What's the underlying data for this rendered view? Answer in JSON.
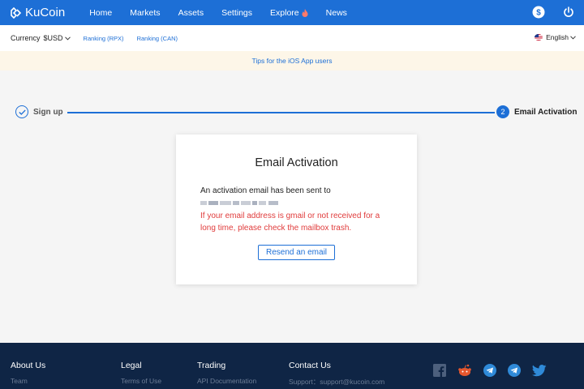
{
  "brand": {
    "name": "KuCoin"
  },
  "nav": {
    "links": [
      "Home",
      "Markets",
      "Assets",
      "Settings",
      "Explore",
      "News"
    ]
  },
  "subbar": {
    "currency_label": "Currency",
    "currency_value": "$USD",
    "ranking_rpx": "Ranking (RPX)",
    "ranking_can": "Ranking (CAN)",
    "language": "English"
  },
  "tips": {
    "text": "Tips for the iOS App users"
  },
  "stepper": {
    "step1_label": "Sign up",
    "step2_number": "2",
    "step2_label": "Email Activation"
  },
  "card": {
    "title": "Email Activation",
    "message": "An activation email has been sent to",
    "warning": "If your email address is gmail or not received for a long time, please check the mailbox trash.",
    "resend_label": "Resend an email"
  },
  "footer": {
    "about_title": "About Us",
    "about_link": "Team",
    "legal_title": "Legal",
    "legal_link": "Terms of Use",
    "trading_title": "Trading",
    "trading_link": "API Documentation",
    "contact_title": "Contact Us",
    "contact_link": "Support：support@kucoin.com"
  },
  "icons": {
    "nav_right": [
      "dollar-icon",
      "power-icon"
    ],
    "socials": [
      "facebook-icon",
      "reddit-icon",
      "telegram-icon",
      "telegram-icon",
      "twitter-icon"
    ]
  },
  "colors": {
    "brand_blue": "#1d6fd6",
    "warning_red": "#e03c3c",
    "footer_bg": "#0f2545",
    "tips_bg": "#fdf6e8"
  }
}
